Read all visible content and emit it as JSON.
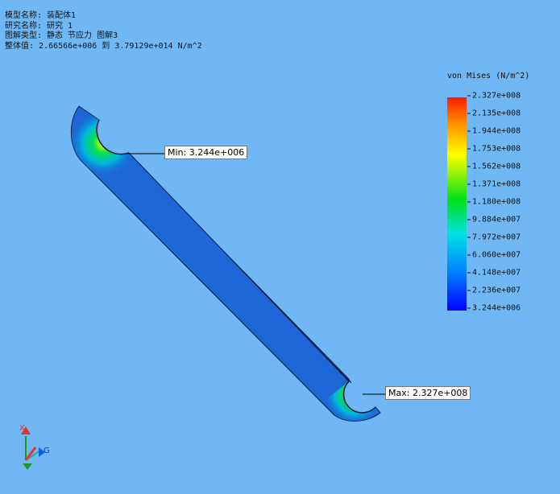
{
  "info": {
    "model_name": "模型名称: 装配体1",
    "study_name": "研究名称: 研究 1",
    "plot_type": "图解类型: 静态 节应力 图解3",
    "value_range": "整体值: 2.66566e+006 到 3.79129e+014 N/m^2"
  },
  "legend": {
    "title": "von Mises (N/m^2)",
    "ticks": [
      "2.327e+008",
      "2.135e+008",
      "1.944e+008",
      "1.753e+008",
      "1.562e+008",
      "1.371e+008",
      "1.180e+008",
      "9.884e+007",
      "7.972e+007",
      "6.060e+007",
      "4.148e+007",
      "2.236e+007",
      "3.244e+006"
    ]
  },
  "callouts": {
    "min": "Min: 3.244e+006",
    "max": "Max: 2.327e+008"
  },
  "triad": {
    "x": "X",
    "z": "Z",
    "g": "G"
  }
}
